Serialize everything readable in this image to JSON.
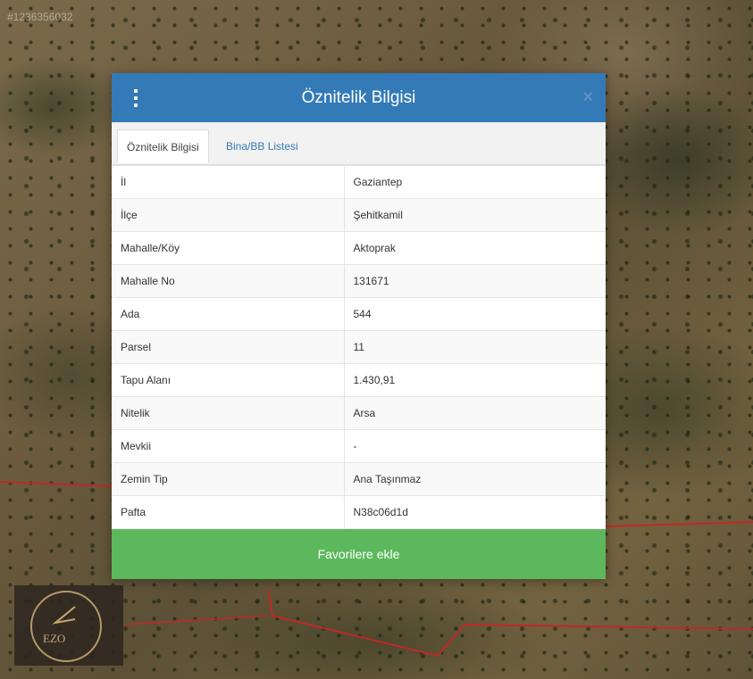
{
  "map": {
    "id_label": "#1236356032"
  },
  "dialog": {
    "title": "Öznitelik Bilgisi",
    "close_label": "×",
    "tabs": [
      {
        "label": "Öznitelik Bilgisi",
        "active": true
      },
      {
        "label": "Bina/BB Listesi",
        "active": false
      }
    ],
    "rows": [
      {
        "key": "İl",
        "value": "Gaziantep"
      },
      {
        "key": "İlçe",
        "value": "Şehitkamil"
      },
      {
        "key": "Mahalle/Köy",
        "value": "Aktoprak"
      },
      {
        "key": "Mahalle No",
        "value": "131671"
      },
      {
        "key": "Ada",
        "value": "544"
      },
      {
        "key": "Parsel",
        "value": "11"
      },
      {
        "key": "Tapu Alanı",
        "value": "1.430,91"
      },
      {
        "key": "Nitelik",
        "value": "Arsa"
      },
      {
        "key": "Mevkii",
        "value": "-"
      },
      {
        "key": "Zemin Tip",
        "value": "Ana Taşınmaz"
      },
      {
        "key": "Pafta",
        "value": "N38c06d1d"
      }
    ],
    "favorite_button": "Favorilere ekle"
  },
  "logo": {
    "text": "EZO"
  },
  "colors": {
    "header": "#337ab7",
    "button": "#5cb85c",
    "parcel_line": "#c0282a"
  }
}
